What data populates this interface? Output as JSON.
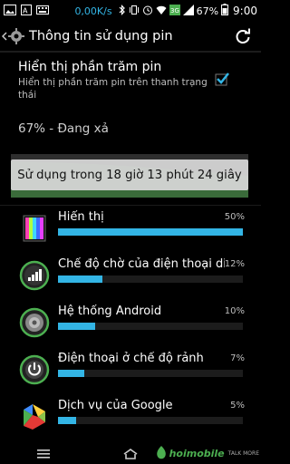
{
  "status_bar": {
    "net_speed": "0,00K/s",
    "battery_percent": "67%",
    "time": "9:00",
    "signal_label": "3G"
  },
  "action_bar": {
    "title": "Thông tin sử dụng pin"
  },
  "setting": {
    "title": "Hiển thị phần trăm pin",
    "subtitle": "Hiển thị phần trăm pin trên thanh trạng thái",
    "checked": true
  },
  "battery_status": "67% - Đang xả",
  "usage_toast": "Sử dụng trong 18 giờ 13 phút 24 giây",
  "apps": [
    {
      "name": "Hiển thị",
      "percent": "50%",
      "value": 50,
      "icon": "display-icon"
    },
    {
      "name": "Chế độ chờ của điện thoại di động",
      "percent": "12%",
      "value": 12,
      "icon": "cell-standby-icon"
    },
    {
      "name": "Hệ thống Android",
      "percent": "10%",
      "value": 10,
      "icon": "android-system-icon"
    },
    {
      "name": "Điện thoại ở chế độ rảnh",
      "percent": "7%",
      "value": 7,
      "icon": "phone-idle-icon"
    },
    {
      "name": "Dịch vụ của Google",
      "percent": "5%",
      "value": 5,
      "icon": "google-play-services-icon"
    }
  ],
  "watermark": {
    "brand": "hoimobile",
    "tagline": "TALK MORE"
  },
  "colors": {
    "accent": "#33b5e5",
    "checkbox": "#33b5e5",
    "watermark_green": "#4caf50"
  }
}
